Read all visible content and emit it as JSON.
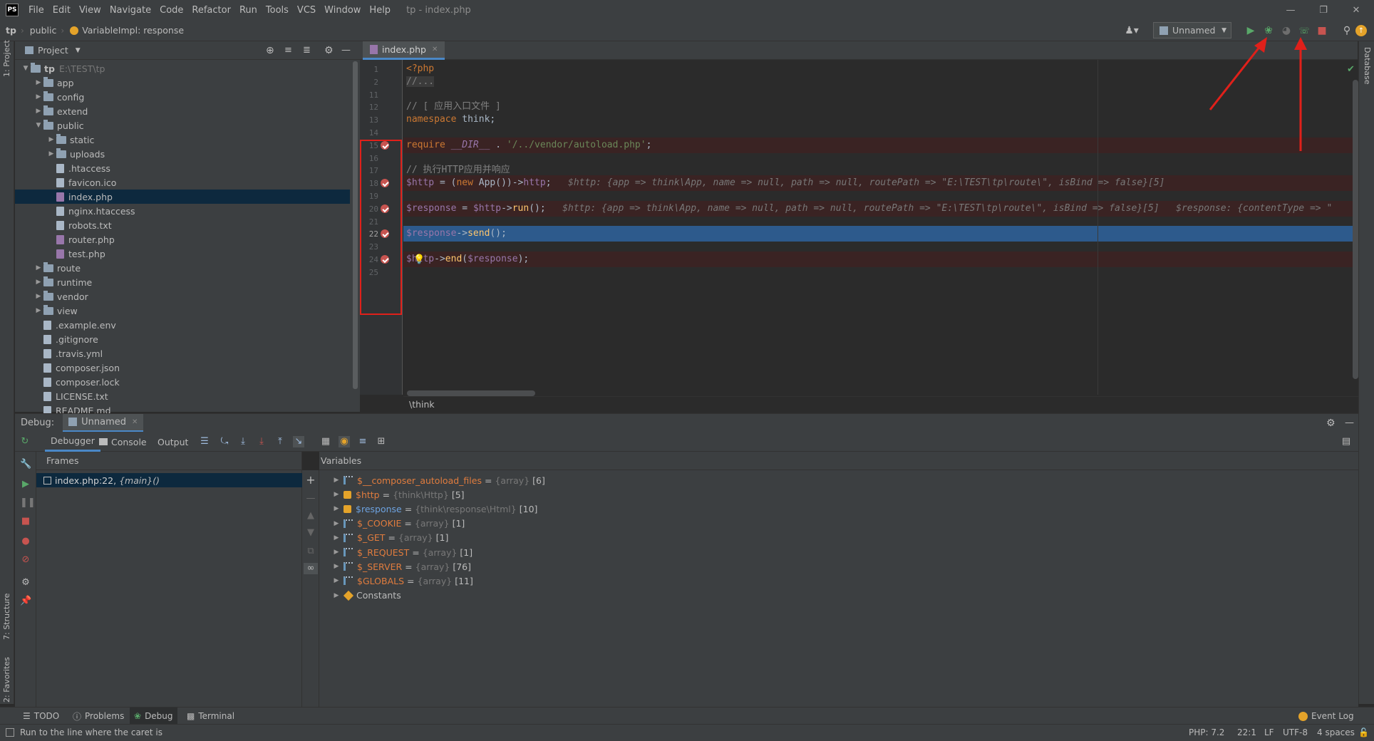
{
  "menubar": {
    "logo": "PS",
    "items": [
      "File",
      "Edit",
      "View",
      "Navigate",
      "Code",
      "Refactor",
      "Run",
      "Tools",
      "VCS",
      "Window",
      "Help"
    ],
    "window_title": "tp - index.php"
  },
  "navbar": {
    "crumbs": [
      "tp",
      "public"
    ],
    "context": "VariableImpl: response",
    "run_config": "Unnamed"
  },
  "left_strip": {
    "project": "1: Project",
    "structure": "7: Structure",
    "favorites": "2: Favorites"
  },
  "right_strip": {
    "database": "Database"
  },
  "project": {
    "header": "Project",
    "tree": [
      {
        "label": "tp",
        "hint": "E:\\TEST\\tp",
        "type": "folder",
        "depth": 0,
        "expanded": true
      },
      {
        "label": "app",
        "type": "folder",
        "depth": 1
      },
      {
        "label": "config",
        "type": "folder",
        "depth": 1
      },
      {
        "label": "extend",
        "type": "folder",
        "depth": 1
      },
      {
        "label": "public",
        "type": "folder",
        "depth": 1,
        "expanded": true
      },
      {
        "label": "static",
        "type": "folder",
        "depth": 2
      },
      {
        "label": "uploads",
        "type": "folder",
        "depth": 2
      },
      {
        "label": ".htaccess",
        "type": "file",
        "depth": 2
      },
      {
        "label": "favicon.ico",
        "type": "file",
        "depth": 2
      },
      {
        "label": "index.php",
        "type": "php",
        "depth": 2,
        "selected": true
      },
      {
        "label": "nginx.htaccess",
        "type": "file",
        "depth": 2
      },
      {
        "label": "robots.txt",
        "type": "file",
        "depth": 2
      },
      {
        "label": "router.php",
        "type": "php",
        "depth": 2
      },
      {
        "label": "test.php",
        "type": "php",
        "depth": 2
      },
      {
        "label": "route",
        "type": "folder",
        "depth": 1
      },
      {
        "label": "runtime",
        "type": "folder",
        "depth": 1
      },
      {
        "label": "vendor",
        "type": "folder",
        "depth": 1
      },
      {
        "label": "view",
        "type": "folder",
        "depth": 1
      },
      {
        "label": ".example.env",
        "type": "file",
        "depth": 1
      },
      {
        "label": ".gitignore",
        "type": "file",
        "depth": 1
      },
      {
        "label": ".travis.yml",
        "type": "file",
        "depth": 1
      },
      {
        "label": "composer.json",
        "type": "file",
        "depth": 1
      },
      {
        "label": "composer.lock",
        "type": "file",
        "depth": 1
      },
      {
        "label": "LICENSE.txt",
        "type": "file",
        "depth": 1
      },
      {
        "label": "README.md",
        "type": "file",
        "depth": 1
      }
    ]
  },
  "editor": {
    "tab": "index.php",
    "breadcrumb": "\\think",
    "lines": [
      {
        "n": "1",
        "html": "<span class='kw'>&lt;?php</span>"
      },
      {
        "n": "2",
        "html": "<span class='cmt' style='background:#3b3b3b'>//...</span>"
      },
      {
        "n": "11",
        "html": ""
      },
      {
        "n": "12",
        "html": "<span class='cmt'>// [ 应用入口文件 ]</span>"
      },
      {
        "n": "13",
        "html": "<span class='kw'>namespace </span><span class='txt'>think;</span>"
      },
      {
        "n": "14",
        "html": ""
      },
      {
        "n": "15",
        "bp": true,
        "html": "<span class='kw'>require </span><span class='var' style='font-style:italic'>__DIR__</span><span class='txt'> . </span><span class='str'>'/../vendor/autoload.php'</span><span class='txt'>;</span>"
      },
      {
        "n": "16",
        "html": ""
      },
      {
        "n": "17",
        "html": "<span class='cmt'>// 执行HTTP应用并响应</span>"
      },
      {
        "n": "18",
        "bp": true,
        "html": "<span class='var'>$http</span><span class='txt'> = (</span><span class='kw'>new </span><span class='txt'>App())-></span><span class='var'>http</span><span class='txt'>;</span>   <span class='inl'>$http: {app => think\\App, name => null, path => null, routePath => \"E:\\TEST\\tp\\route\\\", isBind => false}[5]</span>"
      },
      {
        "n": "19",
        "html": ""
      },
      {
        "n": "20",
        "bp": true,
        "html": "<span class='var'>$response</span><span class='txt'> = </span><span class='var'>$http</span><span class='txt'>-></span><span class='fn'>run</span><span class='txt'>();</span>   <span class='inl'>$http: {app => think\\App, name => null, path => null, routePath => \"E:\\TEST\\tp\\route\\\", isBind => false}[5]   $response: {contentType => \"</span>"
      },
      {
        "n": "21",
        "html": ""
      },
      {
        "n": "22",
        "bp": true,
        "current": true,
        "html": "<span class='var'>$response</span><span class='txt'>-></span><span class='fn'>send</span><span class='txt'>();</span>"
      },
      {
        "n": "23",
        "html": ""
      },
      {
        "n": "24",
        "bp": true,
        "html": "<span class='var'>$http</span><span class='txt'>-></span><span class='fn'>end</span><span class='txt'>(</span><span class='var'>$response</span><span class='txt'>);</span>"
      },
      {
        "n": "25",
        "html": ""
      }
    ]
  },
  "debug": {
    "label": "Debug:",
    "session": "Unnamed",
    "tabs": {
      "debugger": "Debugger",
      "console": "Console",
      "output": "Output"
    },
    "frames_title": "Frames",
    "frame": {
      "location": "index.php:22,",
      "context": "{main}()"
    },
    "variables_title": "Variables",
    "variables": [
      {
        "name": "$__composer_autoload_files",
        "type": "{array}",
        "count": "[6]",
        "icon": "array"
      },
      {
        "name": "$http",
        "type": "{think\\Http}",
        "count": "[5]",
        "icon": "object"
      },
      {
        "name": "$response",
        "type": "{think\\response\\Html}",
        "count": "[10]",
        "icon": "object",
        "blue": true
      },
      {
        "name": "$_COOKIE",
        "type": "{array}",
        "count": "[1]",
        "icon": "array"
      },
      {
        "name": "$_GET",
        "type": "{array}",
        "count": "[1]",
        "icon": "array"
      },
      {
        "name": "$_REQUEST",
        "type": "{array}",
        "count": "[1]",
        "icon": "array"
      },
      {
        "name": "$_SERVER",
        "type": "{array}",
        "count": "[76]",
        "icon": "array"
      },
      {
        "name": "$GLOBALS",
        "type": "{array}",
        "count": "[11]",
        "icon": "array"
      },
      {
        "name": "Constants",
        "type": "",
        "count": "",
        "icon": "const"
      }
    ]
  },
  "bottom_tabs": {
    "todo": "TODO",
    "problems": "Problems",
    "debug": "Debug",
    "terminal": "Terminal",
    "event_log": "Event Log"
  },
  "status": {
    "message": "Run to the line where the caret is",
    "php": "PHP: 7.2",
    "position": "22:1",
    "line_sep": "LF",
    "encoding": "UTF-8",
    "indent": "4 spaces"
  },
  "colors": {
    "accent": "#4a88c7",
    "breakpoint": "#c75450",
    "current_line": "#2d5a8c",
    "annotation": "#e0201a"
  }
}
